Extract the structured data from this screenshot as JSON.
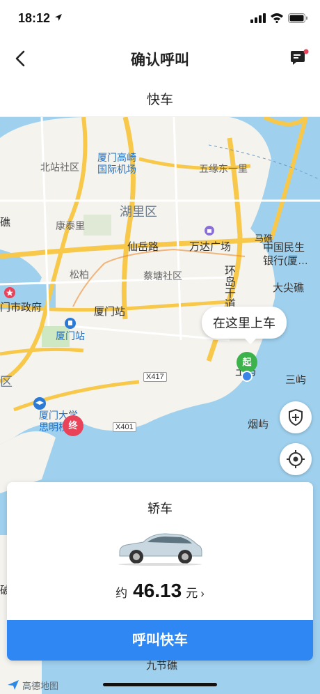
{
  "status_bar": {
    "time": "18:12"
  },
  "nav": {
    "title": "确认呼叫"
  },
  "subtitle": "快车",
  "map": {
    "labels": {
      "airport": "厦门高崎\n国际机场",
      "beizhan": "北站社区",
      "wuyuan": "五缘东一里",
      "huli": "湖里区",
      "kangtai": "康泰里",
      "xianyue": "仙岳路",
      "wanda": "万达广场",
      "songbai": "松柏",
      "caitang": "蔡塘社区",
      "xiamen_station_label": "厦门站",
      "xiamen_station_poi": "厦门站",
      "gov": "门市政府",
      "zhongguo": "中国民生\n银行(厦…",
      "dajian": "大尖礁",
      "huandao": "环岛干道",
      "tuyu": "土屿",
      "sanyu": "三屿",
      "yanyu": "烟屿",
      "xmu": "厦门大学\n思明校区",
      "ji": "礁",
      "qu": "区",
      "po": "破",
      "ma": "马礁",
      "jiujie": "九节礁",
      "tui": "诞"
    },
    "road_tags": {
      "x417": "X417",
      "x401": "X401"
    },
    "bubble": "在这里上车",
    "start_pin": "起",
    "end_pin": "终"
  },
  "card": {
    "car_type": "轿车",
    "approx": "约",
    "price": "46.13",
    "unit": "元",
    "chevron": "›",
    "cta": "呼叫快车"
  },
  "footer": {
    "brand": "高德地图"
  },
  "colors": {
    "primary": "#2e87f2",
    "start": "#3bb34a",
    "end": "#e9435a"
  }
}
